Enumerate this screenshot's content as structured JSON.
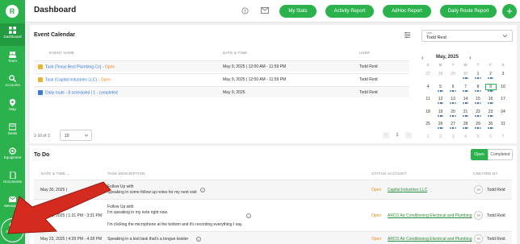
{
  "app": {
    "logo_letter": "R",
    "title": "Dashboard"
  },
  "sidebar": {
    "items": [
      {
        "label": "Dashboard",
        "icon": "dashboard-icon",
        "active": true
      },
      {
        "label": "Team",
        "icon": "team-icon"
      },
      {
        "label": "Accounts",
        "icon": "accounts-icon"
      },
      {
        "label": "Map",
        "icon": "map-icon"
      },
      {
        "label": "Deals",
        "icon": "deals-icon"
      },
      {
        "label": "Equipment",
        "icon": "equipment-icon"
      },
      {
        "label": "Documents",
        "icon": "documents-icon"
      },
      {
        "label": "Messages",
        "icon": "messages-icon"
      },
      {
        "label": "Settings",
        "icon": "settings-icon"
      }
    ]
  },
  "header": {
    "buttons": [
      "My Stats",
      "Activity Report",
      "AdHoc Report",
      "Daily Route Report"
    ],
    "add_label": "+"
  },
  "event_calendar": {
    "title": "Event Calendar",
    "user_select": {
      "label": "User",
      "value": "Todd Reid"
    },
    "columns": [
      "EVENT NAME",
      "DATE & TIME",
      "USER"
    ],
    "rows": [
      {
        "name": "Task (Texas Best Plumbing Co) - ",
        "status": "Open",
        "date": "May 9, 2025 | 12:00 AM - 11:59 PM",
        "user": "Todd Reid",
        "color": "#e5b52b"
      },
      {
        "name": "Task (Capital Industries LLC) - ",
        "status": "Open",
        "date": "May 9, 2025 | 12:00 AM - 11:59 PM",
        "user": "Todd Reid",
        "color": "#e5b52b"
      },
      {
        "name": "Daily route - 8 scheduled | 1 - completed",
        "status": "",
        "date": "May 9, 2025",
        "user": "Todd Reid",
        "color": "#3a7bd5"
      }
    ],
    "pagination": {
      "range": "1-10 of 3",
      "per_page": "10",
      "current": "1"
    }
  },
  "calendar": {
    "month": "May, 2025",
    "dow": [
      "S",
      "M",
      "T",
      "W",
      "T",
      "F",
      "S"
    ],
    "weeks": [
      [
        "27",
        "28",
        "29",
        "30",
        "1",
        "2",
        "3"
      ],
      [
        "4",
        "5",
        "6",
        "7",
        "8",
        "9",
        "10"
      ],
      [
        "11",
        "12",
        "13",
        "14",
        "15",
        "16",
        "17"
      ],
      [
        "18",
        "19",
        "20",
        "21",
        "22",
        "23",
        "24"
      ],
      [
        "25",
        "26",
        "27",
        "28",
        "29",
        "30",
        "31"
      ],
      [
        "1",
        "2",
        "3",
        "4",
        "5",
        "6",
        "7"
      ]
    ]
  },
  "todo": {
    "title": "To Do",
    "tabs": [
      "Open",
      "Completed"
    ],
    "columns": [
      "DATE & TIME",
      "TASK DESCRIPTION",
      "STATUS",
      "ACCOUNT",
      "CREATED BY"
    ],
    "rows": [
      {
        "date": "May 30, 2025 | ",
        "desc1": "Follow Up with",
        "desc2": "Speaking in some follow up notes for my next visit",
        "desc3": "",
        "status": "Open",
        "account": "Capital Industries LLC",
        "initials": "TR",
        "created_by": "Todd Reid"
      },
      {
        "date": "May 23, 2025 | 1:31 PM - 3:31 PM",
        "desc1": "Follow Up with",
        "desc2": "I'm speaking in my note right now.",
        "desc3": "I'm clicking the microphone at the bottom and it's recording everything I say.",
        "status": "Open",
        "account": "ARCO Air Conditioning Electrical and Plumbing",
        "initials": "TR",
        "created_by": "Todd Reid"
      },
      {
        "date": "May 23, 2025 | 4:28 PM - 4:28 PM",
        "desc1": "Speaking in a test task that's a tongue twister",
        "desc2": "",
        "desc3": "",
        "status": "Open",
        "account": "ARCO Air Conditioning Electrical and Plumbing",
        "initials": "TR",
        "created_by": "Todd Reid"
      }
    ]
  },
  "colors": {
    "brand": "#2bb24c",
    "open": "#e58a1f",
    "arrow": "#d52b1e"
  }
}
